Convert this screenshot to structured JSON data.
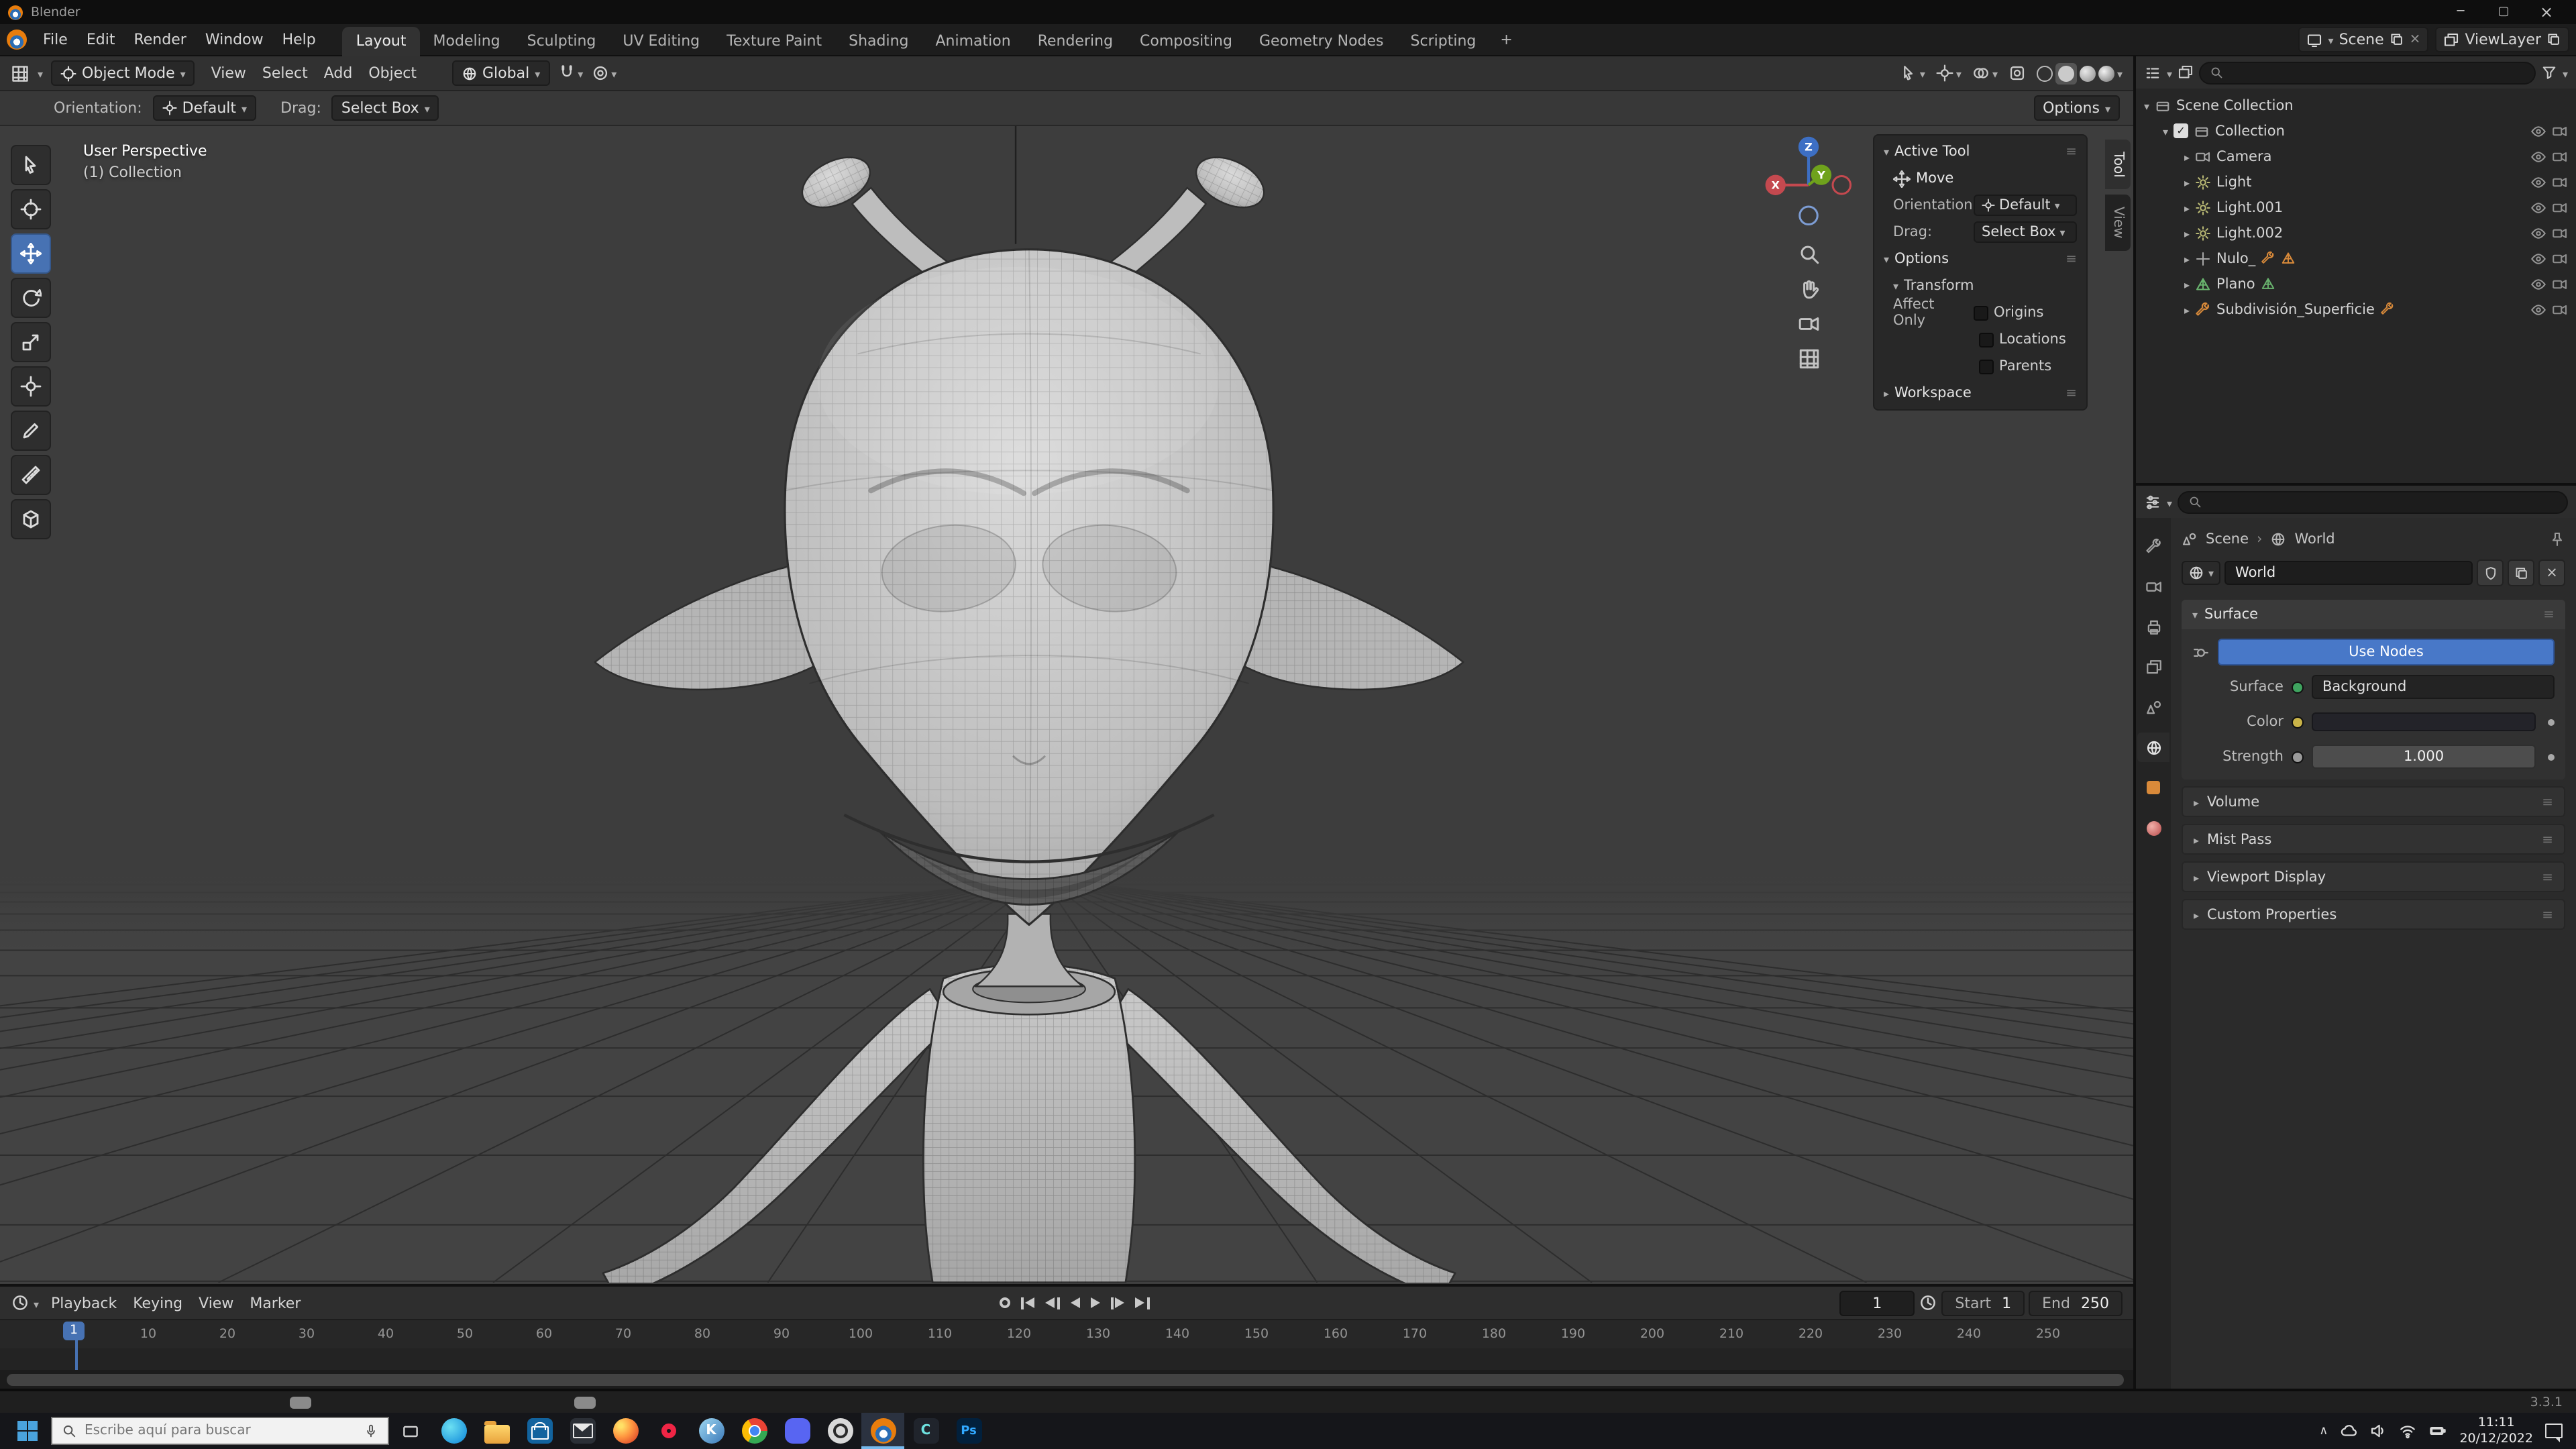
{
  "titlebar": {
    "title": "Blender"
  },
  "topbar": {
    "menus": [
      "File",
      "Edit",
      "Render",
      "Window",
      "Help"
    ],
    "tabs": [
      "Layout",
      "Modeling",
      "Sculpting",
      "UV Editing",
      "Texture Paint",
      "Shading",
      "Animation",
      "Rendering",
      "Compositing",
      "Geometry Nodes",
      "Scripting"
    ],
    "add_tab": "+",
    "scene_label": "Scene",
    "viewlayer_label": "ViewLayer"
  },
  "viewport": {
    "header": {
      "mode": "Object Mode",
      "menus": [
        "View",
        "Select",
        "Add",
        "Object"
      ],
      "orientation": "Global"
    },
    "tool_settings": {
      "orientation_label": "Orientation:",
      "orientation_value": "Default",
      "drag_label": "Drag:",
      "drag_value": "Select Box",
      "options": "Options"
    },
    "overlay": {
      "view_name": "User Perspective",
      "collection": "(1) Collection"
    },
    "gizmo": {
      "x": "X",
      "y": "Y",
      "z": "Z"
    }
  },
  "sidebar_panel": {
    "tabs": {
      "tool": "Tool",
      "view": "View"
    },
    "active_tool_header": "Active Tool",
    "tool_name": "Move",
    "orientation_label": "Orientation",
    "orientation_value": "Default",
    "drag_label": "Drag:",
    "drag_value": "Select Box",
    "options_header": "Options",
    "transform_header": "Transform",
    "affect_only": "Affect Only",
    "checkboxes": [
      "Origins",
      "Locations",
      "Parents"
    ],
    "workspace_header": "Workspace"
  },
  "outliner": {
    "root": "Scene Collection",
    "collection": "Collection",
    "items": [
      "Camera",
      "Light",
      "Light.001",
      "Light.002",
      "Nulo_",
      "Plano",
      "Subdivisión_Superficie"
    ]
  },
  "properties": {
    "breadcrumb": {
      "scene": "Scene",
      "world": "World"
    },
    "datablock_name": "World",
    "surface_panel": "Surface",
    "use_nodes": "Use Nodes",
    "surface_label": "Surface",
    "surface_value": "Background",
    "color_label": "Color",
    "strength_label": "Strength",
    "strength_value": "1.000",
    "collapsed": [
      "Volume",
      "Mist Pass",
      "Viewport Display",
      "Custom Properties"
    ]
  },
  "timeline": {
    "menus": [
      "Playback",
      "Keying",
      "View",
      "Marker"
    ],
    "current_frame": "1",
    "playhead": "1",
    "start_label": "Start",
    "start_value": "1",
    "end_label": "End",
    "end_value": "250",
    "ruler": [
      10,
      20,
      30,
      40,
      50,
      60,
      70,
      80,
      90,
      100,
      110,
      120,
      130,
      140,
      150,
      160,
      170,
      180,
      190,
      200,
      210,
      220,
      230,
      240,
      250
    ]
  },
  "statusbar": {
    "version": "3.3.1"
  },
  "taskbar": {
    "search_placeholder": "Escribe aquí para buscar",
    "apps": [
      {
        "name": "Microsoft Edge",
        "glyph": ""
      },
      {
        "name": "File Explorer",
        "glyph": ""
      },
      {
        "name": "Microsoft Store",
        "glyph": ""
      },
      {
        "name": "Mail",
        "glyph": ""
      },
      {
        "name": "Firefox",
        "glyph": ""
      },
      {
        "name": "Opera",
        "glyph": ""
      },
      {
        "name": "Krita",
        "glyph": "K"
      },
      {
        "name": "Chrome",
        "glyph": ""
      },
      {
        "name": "Discord",
        "glyph": ""
      },
      {
        "name": "OBS",
        "glyph": ""
      },
      {
        "name": "Blender",
        "glyph": ""
      },
      {
        "name": "CapCut",
        "glyph": "C"
      },
      {
        "name": "Photoshop",
        "glyph": "Ps"
      }
    ],
    "clock": {
      "time": "11:11",
      "date": "20/12/2022"
    }
  },
  "icons": {
    "chevron-down": "▾",
    "chevron-right": "▸",
    "panel-grip": "≡",
    "close": "×",
    "minimize": "─",
    "maximize": "▢",
    "check": "✓",
    "record": "●",
    "play": "▶",
    "play-reverse": "◀",
    "jump-start": "|◀",
    "jump-end": "▶|",
    "search": "magnifier",
    "eye": "visibility",
    "camera": "render-visibility"
  },
  "colors": {
    "accent_blue": "#4772b3",
    "use_nodes_blue": "#4878c8",
    "blender_orange": "#e87d0d",
    "socket_shader": "#3fa35f",
    "socket_color": "#c9b348",
    "socket_value": "#9a9a9a",
    "playhead_blue": "#4772b3"
  }
}
